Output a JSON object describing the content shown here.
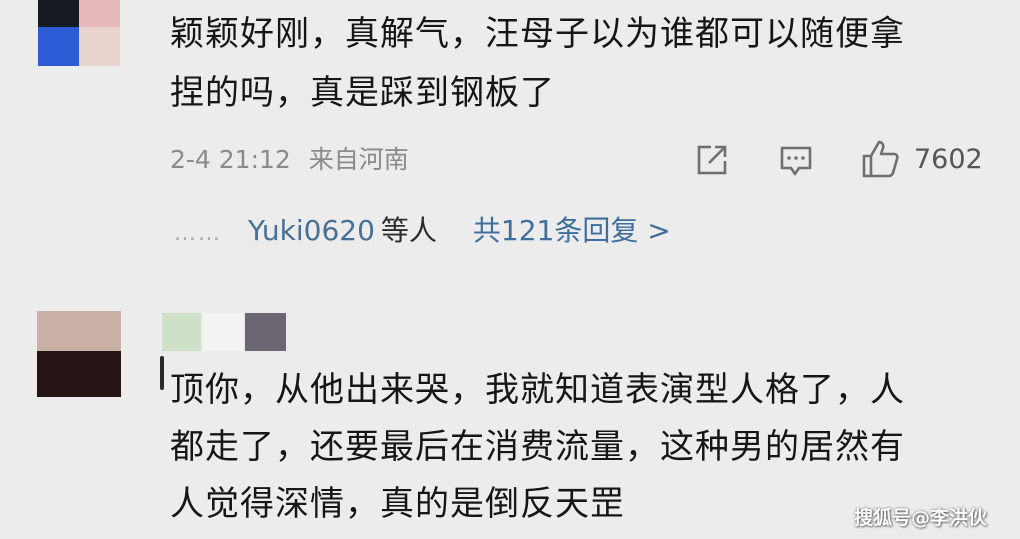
{
  "comment1": {
    "text_line1": "颖颖好刚，真解气，汪母子以为谁都可以随便拿",
    "text_line2": "捏的吗，真是踩到钢板了",
    "timestamp": "2-4 21:12",
    "location": "来自河南",
    "like_count": "7602",
    "replies": {
      "dots": "……",
      "user": "Yuki0620",
      "suffix": "等人",
      "count_link": "共121条回复 >"
    }
  },
  "comment2": {
    "text_line1": "顶你，从他出来哭，我就知道表演型人格了，人",
    "text_line2": "都走了，还要最后在消费流量，这种男的居然有",
    "text_line3": "人觉得深情，真的是倒反天罡"
  },
  "watermark": "搜狐号@李洪伙",
  "colors": {
    "background": "#ececec",
    "link_blue": "#3f6e9c",
    "meta_gray": "#8a8a8a"
  },
  "icons": [
    "share-icon",
    "comment-icon",
    "like-icon"
  ]
}
